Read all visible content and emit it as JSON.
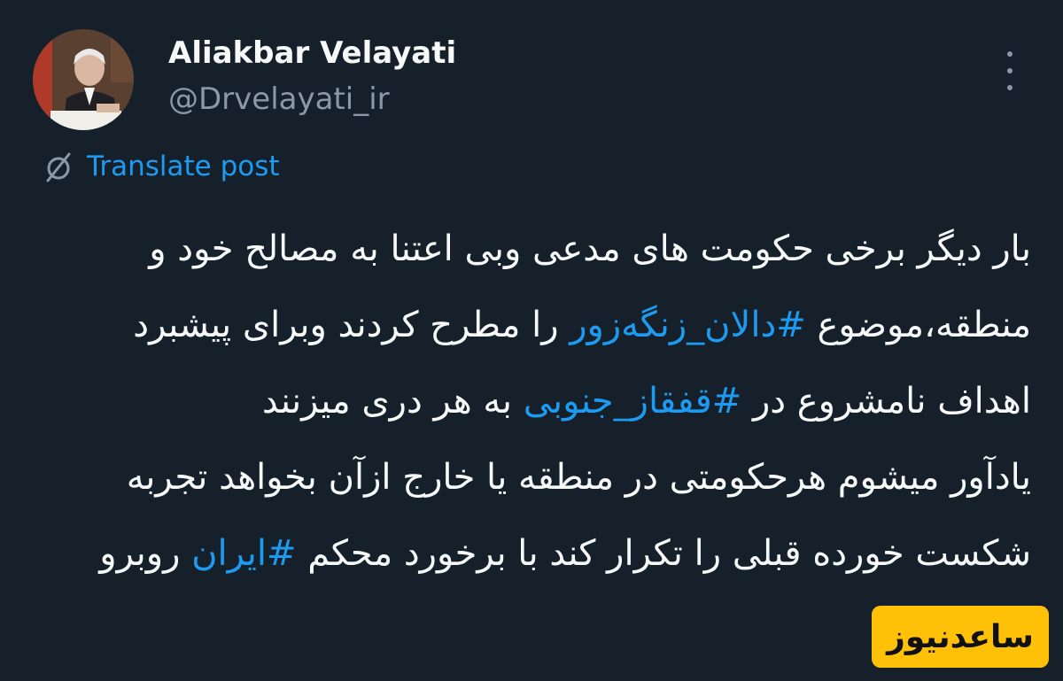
{
  "colors": {
    "background": "#15202b",
    "text_primary": "#f7f9f9",
    "text_secondary": "#8b98a5",
    "link": "#1d9bf0",
    "watermark_bg": "#ffc107"
  },
  "author": {
    "display_name": "Aliakbar Velayati",
    "handle": "@Drvelayati_ir",
    "avatar_icon": "profile-photo"
  },
  "menu": {
    "icon": "more-vertical-icon"
  },
  "translate": {
    "icon": "globe-icon",
    "label": "Translate post"
  },
  "tweet": {
    "line1": "بار دیگر برخی حکومت های مدعی وبی اعتنا به مصالح خود و",
    "line2_before": "منطقه،موضوع ",
    "line2_hashtag": "#دالان_زنگه‌زور",
    "line2_after": " را مطرح کردند وبرای پیشبرد",
    "line3_before": "اهداف نامشروع در  ",
    "line3_hashtag": "#قفقاز_جنوبی",
    "line3_after": " به هر دری میزنند",
    "line4": "یادآور میشوم هرحکومتی در منطقه یا خارج ازآن بخواهد تجربه",
    "line5_before": "شکست خورده قبلی را تکرار کند با برخورد محکم ",
    "line5_hashtag": "#ایران",
    "line5_after": " روبرو"
  },
  "watermark": {
    "text": "ساعدنیوز"
  }
}
